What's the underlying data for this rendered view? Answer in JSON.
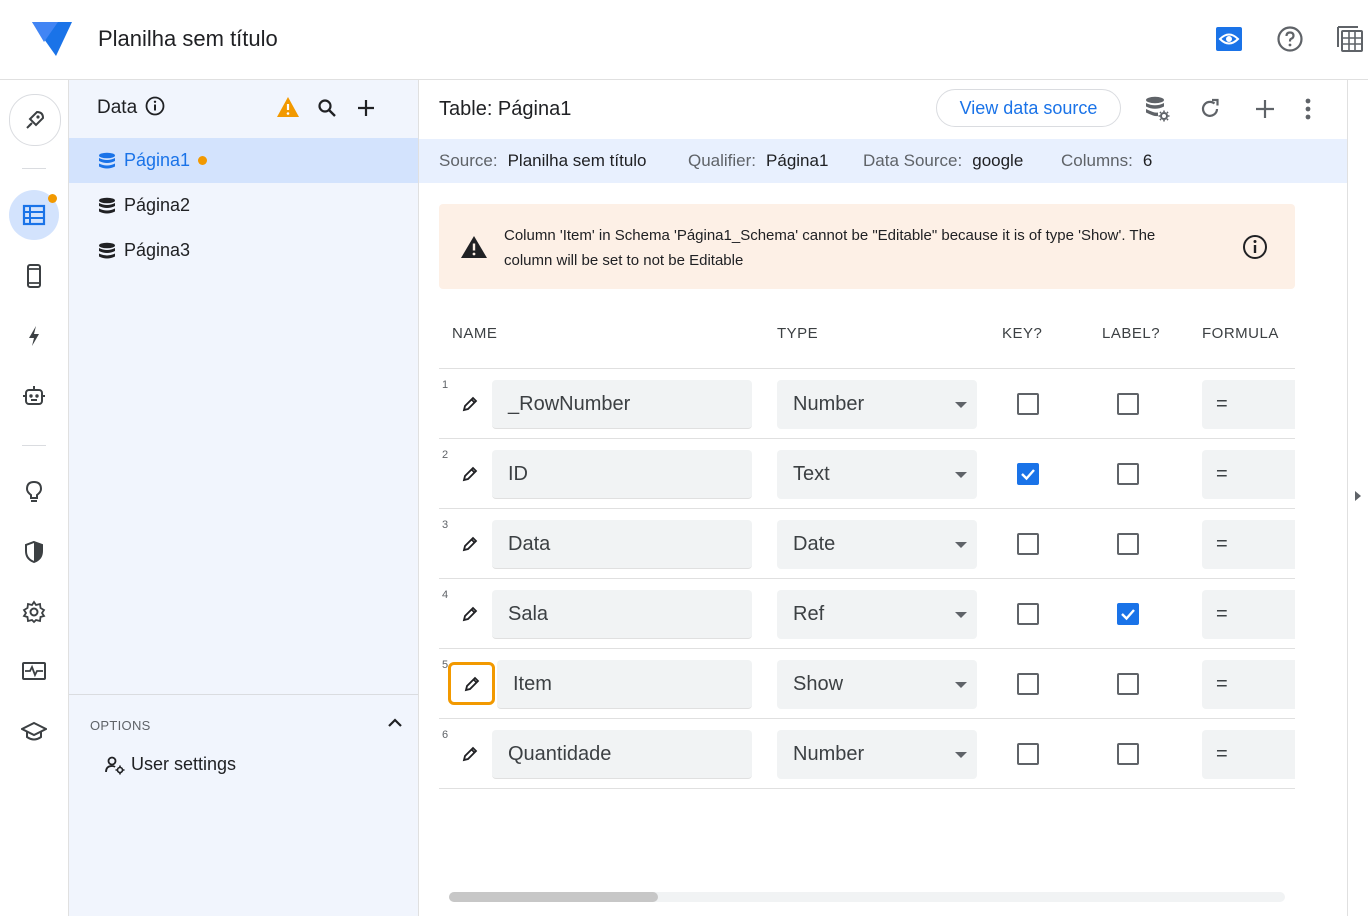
{
  "app": {
    "title": "Planilha sem título",
    "accent": "#1a73e8",
    "warning_color": "#f29900"
  },
  "topbar": {
    "icons": [
      "preview-eye-icon",
      "help-icon",
      "app-grid-icon"
    ]
  },
  "rail": {
    "items": [
      "rocket-icon",
      "data-table-icon",
      "phone-icon",
      "bolt-icon",
      "robot-icon",
      "lightbulb-icon",
      "shield-icon",
      "settings-gear-icon",
      "monitor-pulse-icon",
      "school-cap-icon"
    ],
    "active": "data-table-icon"
  },
  "data_panel": {
    "title": "Data",
    "tables": [
      {
        "label": "Página1",
        "selected": true,
        "has_warning_dot": true
      },
      {
        "label": "Página2",
        "selected": false,
        "has_warning_dot": false
      },
      {
        "label": "Página3",
        "selected": false,
        "has_warning_dot": false
      }
    ],
    "options_label": "OPTIONS",
    "user_settings_label": "User settings"
  },
  "main": {
    "table_title": "Table: Página1",
    "view_data_source_label": "View data source",
    "source": {
      "source_label": "Source:",
      "source_value": "Planilha sem título",
      "qualifier_label": "Qualifier:",
      "qualifier_value": "Página1",
      "datasource_label": "Data Source:",
      "datasource_value": "google",
      "columns_label": "Columns:",
      "columns_value": "6"
    },
    "warning": {
      "text": "Column 'Item' in Schema 'Página1_Schema' cannot be \"Editable\" because it is of type 'Show'. The column will be set to not be Editable"
    },
    "headers": {
      "name": "NAME",
      "type": "TYPE",
      "key": "KEY?",
      "label": "LABEL?",
      "formula": "FORMULA"
    },
    "rows": [
      {
        "num": "1",
        "name": "_RowNumber",
        "type": "Number",
        "key": false,
        "label": false,
        "formula": "="
      },
      {
        "num": "2",
        "name": "ID",
        "type": "Text",
        "key": true,
        "label": false,
        "formula": "="
      },
      {
        "num": "3",
        "name": "Data",
        "type": "Date",
        "key": false,
        "label": false,
        "formula": "="
      },
      {
        "num": "4",
        "name": "Sala",
        "type": "Ref",
        "key": false,
        "label": true,
        "formula": "="
      },
      {
        "num": "5",
        "name": "Item",
        "type": "Show",
        "key": false,
        "label": false,
        "formula": "="
      },
      {
        "num": "6",
        "name": "Quantidade",
        "type": "Number",
        "key": false,
        "label": false,
        "formula": "="
      }
    ],
    "focused_row": 4
  }
}
